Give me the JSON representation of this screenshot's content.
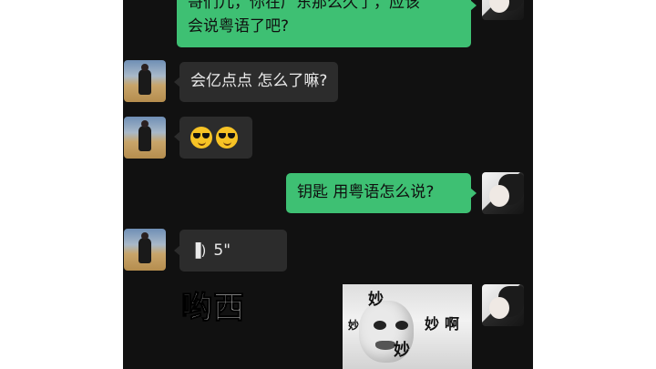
{
  "messages": {
    "m1": {
      "line1": "哥们儿，你在广东那么久了，应该",
      "line2": "会说粤语了吧?"
    },
    "m2": "会亿点点 怎么了嘛?",
    "m3": "cool-emoji ×2",
    "m4": "钥匙 用粤语怎么说?",
    "m5": {
      "icon": "voice-icon",
      "duration": "5\""
    }
  },
  "caption": "哟西",
  "sticker": {
    "t1": "妙",
    "t2": "妙",
    "t3": "妙",
    "t4": "啊",
    "t5": "妙"
  },
  "colors": {
    "background": "#111111",
    "outgoing_bubble": "#3ec073",
    "incoming_bubble": "#2c2c2c"
  }
}
